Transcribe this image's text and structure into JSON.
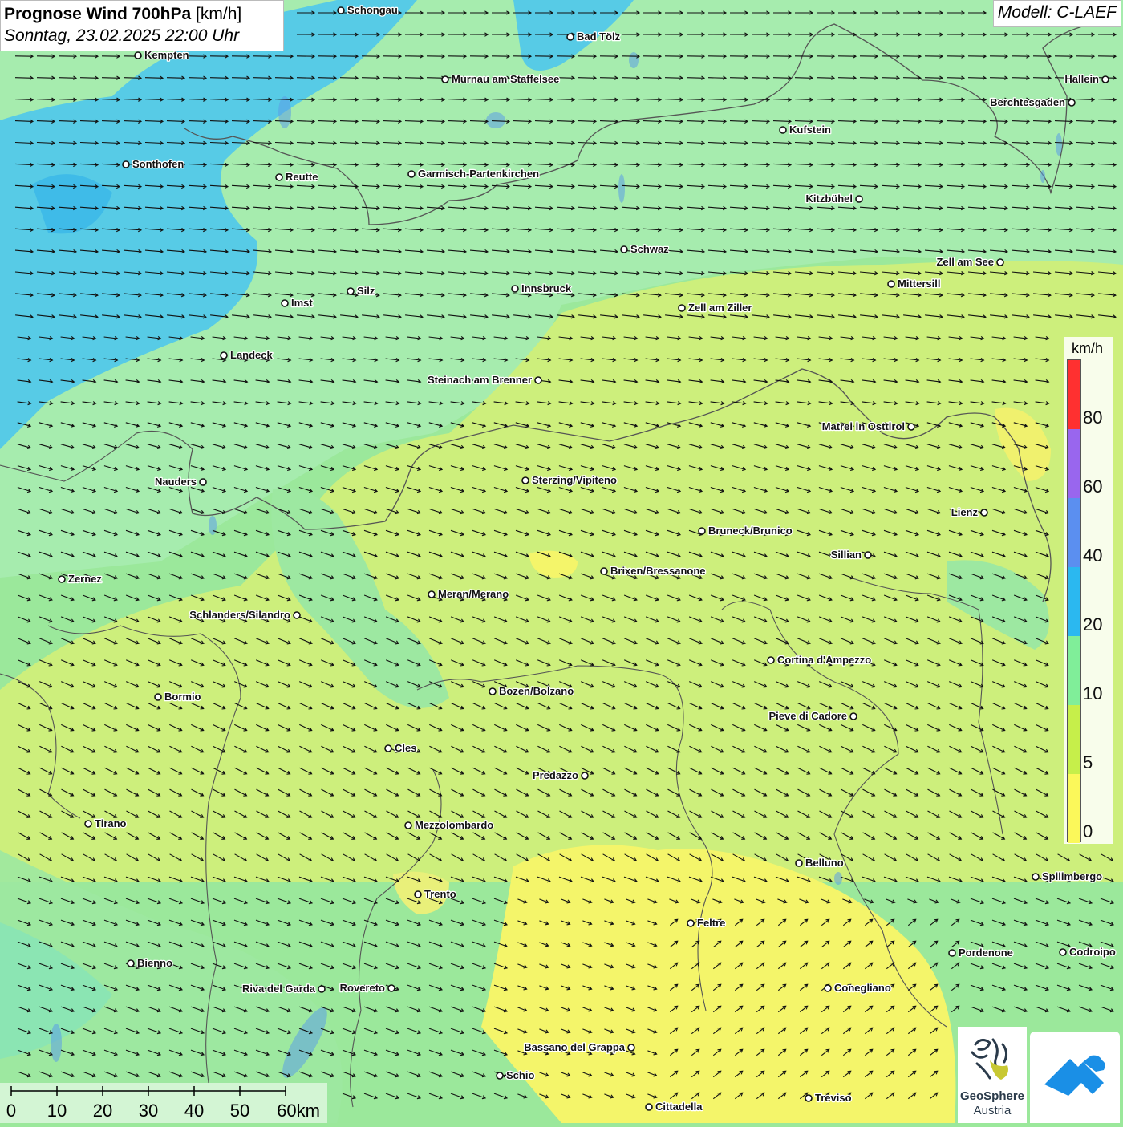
{
  "header": {
    "title_bold": "Prognose Wind 700hPa",
    "title_unit": " [km/h]",
    "subtitle": "Sonntag, 23.02.2025 22:00 Uhr",
    "model": "Modell: C-LAEF"
  },
  "legend": {
    "unit": "km/h",
    "labels": [
      "80",
      "60",
      "40",
      "20",
      "10",
      "5",
      "0"
    ],
    "colors": [
      "#ff3030",
      "#9966ee",
      "#5b8ff0",
      "#2bb8f0",
      "#80ee99",
      "#c6ef4a",
      "#fbf85a"
    ]
  },
  "scale_bar": {
    "labels": [
      "0",
      "10",
      "20",
      "30",
      "40",
      "50",
      "60km"
    ]
  },
  "cities": [
    {
      "name": "Schongau",
      "side": "right"
    },
    {
      "name": "Bad Tölz",
      "side": "right"
    },
    {
      "name": "Kempten",
      "side": "right"
    },
    {
      "name": "Murnau am Staffelsee",
      "side": "right"
    },
    {
      "name": "Hallein",
      "side": "left"
    },
    {
      "name": "Berchtesgaden",
      "side": "left"
    },
    {
      "name": "Kufstein",
      "side": "right"
    },
    {
      "name": "Sonthofen",
      "side": "right"
    },
    {
      "name": "Reutte",
      "side": "right"
    },
    {
      "name": "Garmisch-Partenkirchen",
      "side": "right"
    },
    {
      "name": "Kitzbühel",
      "side": "left"
    },
    {
      "name": "Schwaz",
      "side": "right"
    },
    {
      "name": "Zell am See",
      "side": "left"
    },
    {
      "name": "Innsbruck",
      "side": "right"
    },
    {
      "name": "Mittersill",
      "side": "right"
    },
    {
      "name": "Silz",
      "side": "right"
    },
    {
      "name": "Imst",
      "side": "right"
    },
    {
      "name": "Zell am Ziller",
      "side": "right"
    },
    {
      "name": "Landeck",
      "side": "right"
    },
    {
      "name": "Steinach am Brenner",
      "side": "left"
    },
    {
      "name": "Matrei in Osttirol",
      "side": "left"
    },
    {
      "name": "Nauders",
      "side": "left"
    },
    {
      "name": "Sterzing/Vipiteno",
      "side": "right"
    },
    {
      "name": "Lienz",
      "side": "left"
    },
    {
      "name": "Bruneck/Brunico",
      "side": "right"
    },
    {
      "name": "Sillian",
      "side": "left"
    },
    {
      "name": "Brixen/Bressanone",
      "side": "right"
    },
    {
      "name": "Zernez",
      "side": "right"
    },
    {
      "name": "Meran/Merano",
      "side": "right"
    },
    {
      "name": "Schlanders/Silandro",
      "side": "left"
    },
    {
      "name": "Cortina d'Ampezzo",
      "side": "right"
    },
    {
      "name": "Bozen/Bolzano",
      "side": "right"
    },
    {
      "name": "Bormio",
      "side": "right"
    },
    {
      "name": "Pieve di Cadore",
      "side": "left"
    },
    {
      "name": "Cles",
      "side": "right"
    },
    {
      "name": "Predazzo",
      "side": "left"
    },
    {
      "name": "Tirano",
      "side": "right"
    },
    {
      "name": "Mezzolombardo",
      "side": "right"
    },
    {
      "name": "Belluno",
      "side": "right"
    },
    {
      "name": "Spilimbergo",
      "side": "right"
    },
    {
      "name": "Trento",
      "side": "right"
    },
    {
      "name": "Feltre",
      "side": "right"
    },
    {
      "name": "Pordenone",
      "side": "right"
    },
    {
      "name": "Codroipo",
      "side": "right"
    },
    {
      "name": "Bienno",
      "side": "right"
    },
    {
      "name": "Riva del Garda",
      "side": "left"
    },
    {
      "name": "Rovereto",
      "side": "left"
    },
    {
      "name": "Conegliano",
      "side": "right"
    },
    {
      "name": "Bassano del Grappa",
      "side": "left"
    },
    {
      "name": "Schio",
      "side": "right"
    },
    {
      "name": "Treviso",
      "side": "right"
    },
    {
      "name": "Cittadella",
      "side": "right"
    }
  ],
  "logos": {
    "geosphere_line1": "GeoSphere",
    "geosphere_line2": "Austria"
  }
}
